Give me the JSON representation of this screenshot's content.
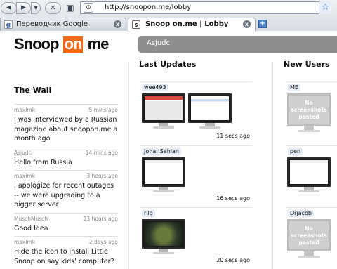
{
  "browser": {
    "back_glyph": "◀",
    "fwd_glyph": "▶",
    "drop_glyph": "▼",
    "stop_glyph": "✕",
    "url": "http://snoopon.me/lobby",
    "tabs": [
      {
        "label": "Переводчик Google",
        "active": false
      },
      {
        "label": "Snoop on.me | Lobby",
        "active": true
      }
    ]
  },
  "site": {
    "logo": {
      "part1": "Snoop",
      "part2": "on",
      "part3": "me"
    },
    "search_value": "Asjudc",
    "brand_color": "#f06a14"
  },
  "wall": {
    "title": "The Wall",
    "posts": [
      {
        "author": "maximk",
        "time": "5 mins ago",
        "text": "I was interviewed by a Russian magazine about snoopon.me a month ago"
      },
      {
        "author": "Asjudc",
        "time": "14 mins ago",
        "text": "Hello from Russia"
      },
      {
        "author": "maximk",
        "time": "3 hours ago",
        "text": "I apologize for recent outages -- we were upgrading to a bigger server"
      },
      {
        "author": "MuschMusch",
        "time": "13 hours ago",
        "text": "Good Idea"
      },
      {
        "author": "maximk",
        "time": "2 days ago",
        "text": "Hide the icon to install Little Snoop on say kids' computer?"
      }
    ]
  },
  "updates": {
    "title": "Last Updates",
    "items": [
      {
        "user": "wee493",
        "time": "11 secs ago"
      },
      {
        "user": "JoharlSahlan",
        "time": "16 secs ago"
      },
      {
        "user": "rilo",
        "time": "20 secs ago"
      }
    ]
  },
  "new_users": {
    "title": "New Users",
    "items": [
      {
        "user": "ME",
        "placeholder": "No screenshots posted"
      },
      {
        "user": "pen",
        "placeholder": ""
      },
      {
        "user": "Drjacob",
        "placeholder": "No screenshots posted"
      }
    ]
  }
}
